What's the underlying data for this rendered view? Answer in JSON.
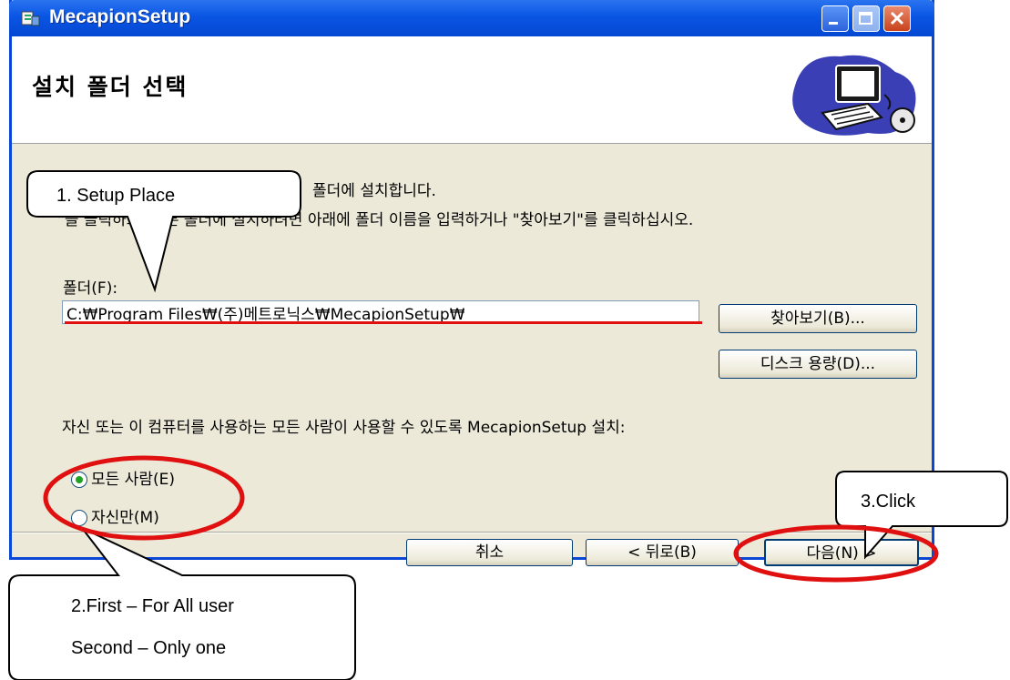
{
  "window": {
    "title": "MecapionSetup",
    "controls": [
      "minimize",
      "maximize",
      "close"
    ]
  },
  "banner": {
    "title": "설치 폴더 선택",
    "art_icon": "computer-clipart-icon"
  },
  "description": {
    "line1": "폴더에 설치합니다.",
    "line2": "\"을 클릭하고, 다른 폴더에 설치하려면 아래에 폴더 이름을 입력하거나 \"찾아보기\"를 클릭하십시오."
  },
  "folder": {
    "label": "폴더(F):",
    "value": "C:₩Program Files₩(주)메트로닉스₩MecapionSetup₩"
  },
  "buttons": {
    "browse": "찾아보기(B)...",
    "disk_cost": "디스크 용량(D)...",
    "cancel": "취소",
    "back": "< 뒤로(B)",
    "next": "다음(N) >"
  },
  "install_for": {
    "label": "자신 또는 이 컴퓨터를 사용하는 모든 사람이 사용할 수 있도록 MecapionSetup 설치:",
    "options": [
      {
        "label": "모든 사람(E)",
        "selected": true
      },
      {
        "label": "자신만(M)",
        "selected": false
      }
    ]
  },
  "annotations": {
    "callout1": "1. Setup Place",
    "callout2_line1": "2.First – For All user",
    "callout2_line2": "Second – Only one",
    "callout3": "3.Click",
    "highlight_color": "#e01010"
  }
}
